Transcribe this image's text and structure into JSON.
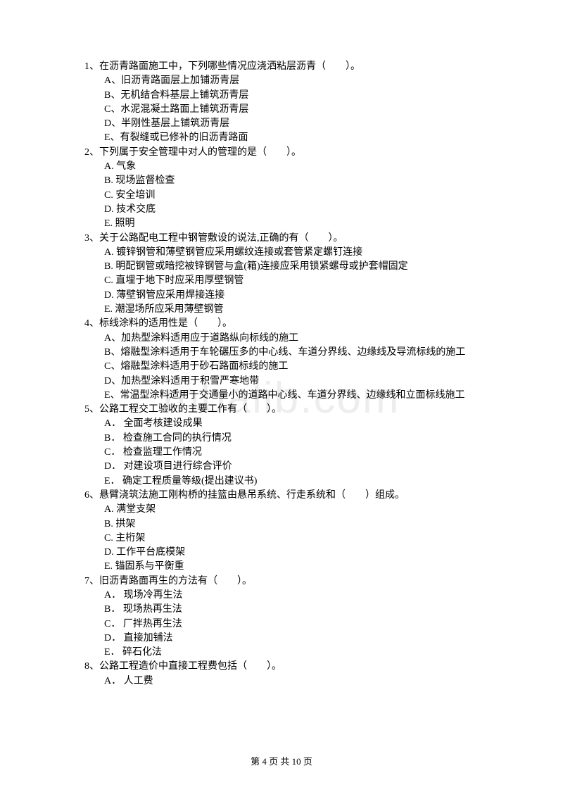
{
  "watermark": "mbalib.com",
  "questions": [
    {
      "q": "1、在沥青路面施工中，下列哪些情况应浇洒粘层沥青（　　）。",
      "opts": [
        "A、旧沥青路面层上加铺沥青层",
        "B、无机结合料基层上铺筑沥青层",
        "C、水泥混凝土路面上铺筑沥青层",
        "D、半刚性基层上铺筑沥青层",
        "E、有裂缝或已修补的旧沥青路面"
      ]
    },
    {
      "q": "2、下列属于安全管理中对人的管理的是（　　）。",
      "opts": [
        "A. 气象",
        "B. 现场监督检查",
        "C. 安全培训",
        "D. 技术交底",
        "E. 照明"
      ]
    },
    {
      "q": "3、关于公路配电工程中钢管敷设的说法,正确的有（　　）。",
      "opts": [
        "A. 镀锌钢管和薄壁钢管应采用螺纹连接或套管紧定螺钉连接",
        "B. 明配钢管或暗挖被锌钢管与盒(箱)连接应采用锁紧螺母或护套帽固定",
        "C. 直埋于地下时应采用厚壁钢管",
        "D. 薄壁钢管应采用焊接连接",
        "E. 潮湿场所应采用薄壁钢管"
      ]
    },
    {
      "q": "4、标线涂料的适用性是（　　）。",
      "opts": [
        "A、加热型涂料适用应于道路纵向标线的施工",
        "B、熔融型涂料适用于车轮碾压多的中心线、车道分界线、边缘线及导流标线的施工",
        "C、熔融型涂料适用于砂石路面标线的施工",
        "D、加热型涂料适用于积雪严寒地带",
        "E、常温型涂料适用于交通量小的道路中心线、车道分界线、边缘线和立面标线施工"
      ]
    },
    {
      "q": "5、公路工程交工验收的主要工作有（　　）。",
      "opts": [
        "A． 全面考核建设成果",
        "B． 检查施工合同的执行情况",
        "C． 检查监理工作情况",
        "D． 对建设项目进行综合评价",
        "E． 确定工程质量等级(提出建议书)"
      ]
    },
    {
      "q": "6、悬臂浇筑法施工刚构桥的挂篮由悬吊系统、行走系统和（　　）组成。",
      "opts": [
        "A. 满堂支架",
        "B. 拱架",
        "C. 主桁架",
        "D. 工作平台底模架",
        "E. 锚固系与平衡重"
      ]
    },
    {
      "q": "7、旧沥青路面再生的方法有（　　）。",
      "opts": [
        "A． 现场冷再生法",
        "B． 现场热再生法",
        "C． 厂拌热再生法",
        "D． 直接加铺法",
        "E． 碎石化法"
      ]
    },
    {
      "q": "8、公路工程造价中直接工程费包括（　　）。",
      "opts": [
        "A． 人工费"
      ]
    }
  ],
  "footer": "第 4 页 共 10 页"
}
